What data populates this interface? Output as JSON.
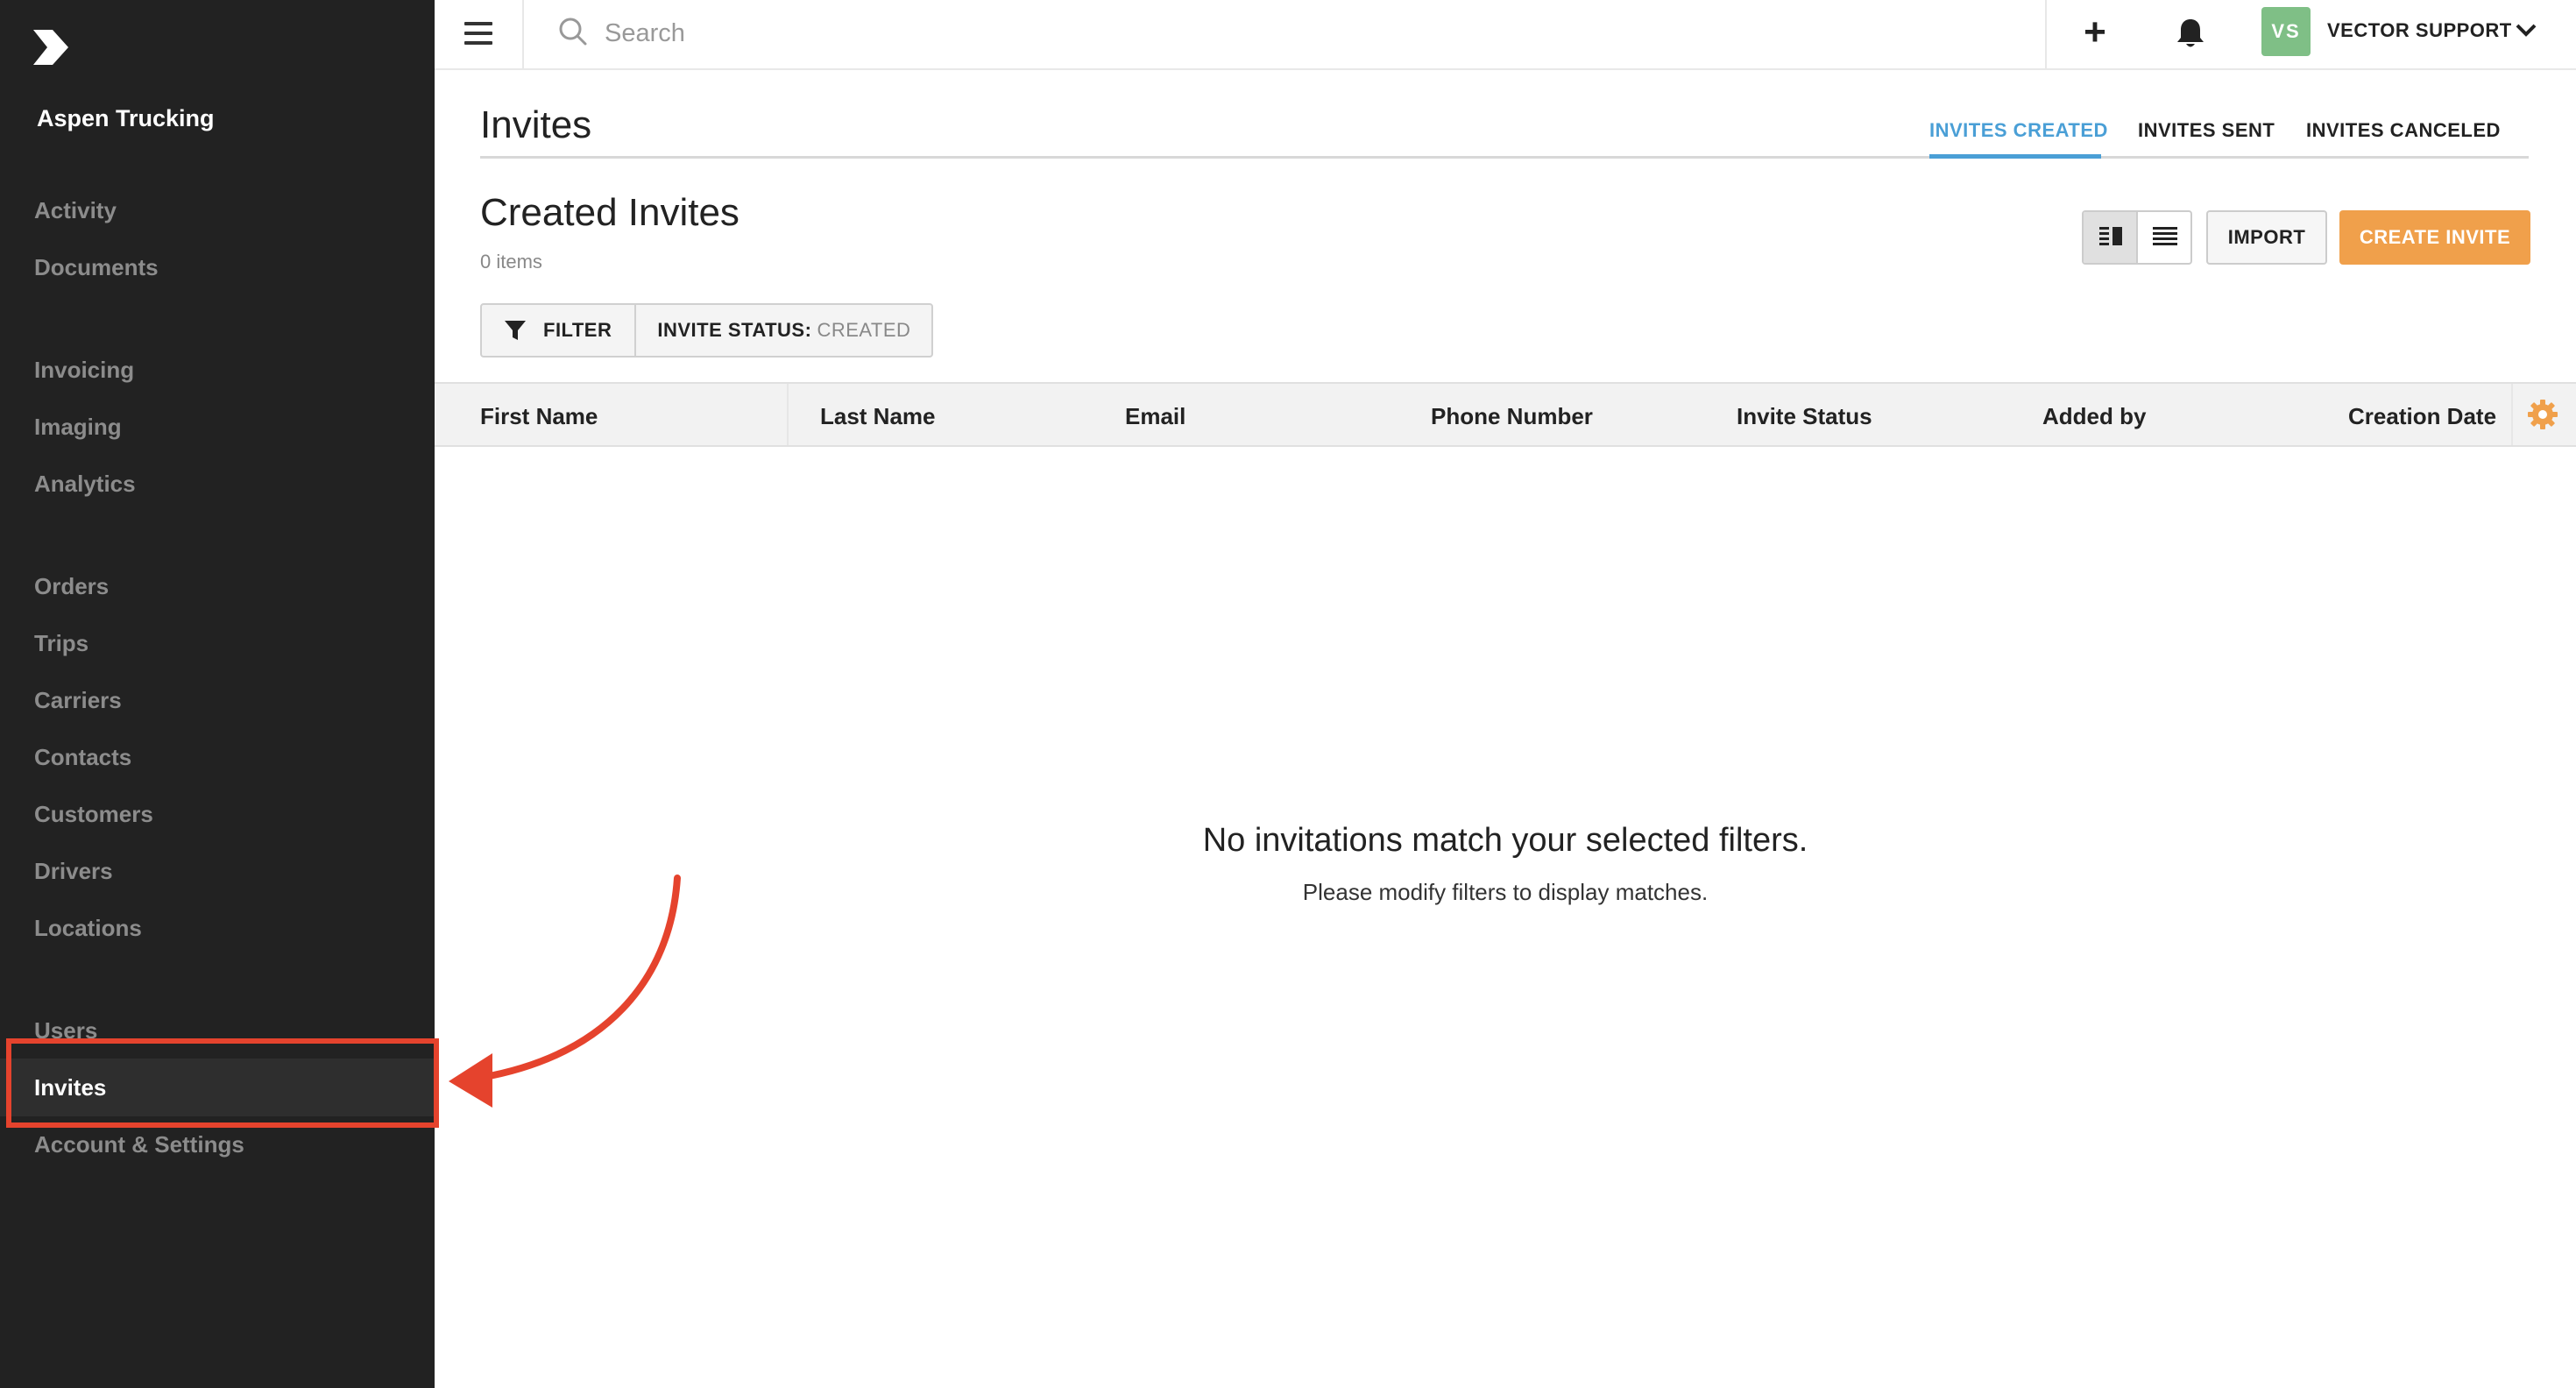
{
  "sidebar": {
    "company": "Aspen Trucking",
    "items": [
      {
        "label": "Activity"
      },
      {
        "label": "Documents"
      },
      {
        "label": "Invoicing"
      },
      {
        "label": "Imaging"
      },
      {
        "label": "Analytics"
      },
      {
        "label": "Orders"
      },
      {
        "label": "Trips"
      },
      {
        "label": "Carriers"
      },
      {
        "label": "Contacts"
      },
      {
        "label": "Customers"
      },
      {
        "label": "Drivers"
      },
      {
        "label": "Locations"
      },
      {
        "label": "Users"
      },
      {
        "label": "Invites"
      },
      {
        "label": "Account & Settings"
      }
    ],
    "active_item": "Invites"
  },
  "topbar": {
    "search_placeholder": "Search",
    "avatar_initials": "VS",
    "user_name": "VECTOR SUPPORT",
    "icons": [
      "menu-icon",
      "search-icon",
      "plus-icon",
      "bell-icon",
      "chevron-down-icon"
    ]
  },
  "page": {
    "title": "Invites",
    "tabs": [
      {
        "label": "INVITES CREATED",
        "active": true
      },
      {
        "label": "INVITES SENT",
        "active": false
      },
      {
        "label": "INVITES CANCELED",
        "active": false
      }
    ]
  },
  "section": {
    "title": "Created Invites",
    "count": "0 items",
    "import_label": "IMPORT",
    "create_label": "CREATE INVITE",
    "filter_label": "FILTER",
    "status_label": "INVITE STATUS:",
    "status_value": "CREATED"
  },
  "table": {
    "columns": [
      "First Name",
      "Last Name",
      "Email",
      "Phone Number",
      "Invite Status",
      "Added by",
      "Creation Date"
    ]
  },
  "empty": {
    "title": "No invitations match your selected filters.",
    "subtitle": "Please modify filters to display matches."
  },
  "colors": {
    "sidebar_bg": "#222222",
    "accent_blue": "#4a9fd6",
    "create_orange": "#f0a04b",
    "avatar_green": "#7fbf86",
    "annotation_red": "#e5432d"
  }
}
